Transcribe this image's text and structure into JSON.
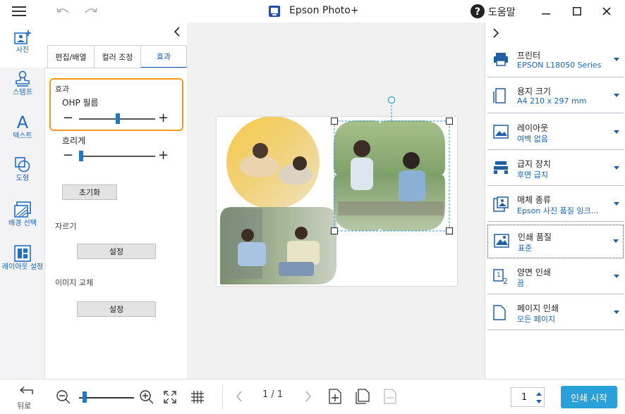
{
  "titlebar": {
    "title": "Epson Photo+",
    "help": "도움말"
  },
  "rail": {
    "items": [
      {
        "label": "사진"
      },
      {
        "label": "스탬프"
      },
      {
        "label": "텍스트"
      },
      {
        "label": "도형"
      },
      {
        "label": "배경 선택"
      },
      {
        "label": "레이아웃 설정"
      }
    ],
    "back_label": "뒤로"
  },
  "panel": {
    "tabs": [
      {
        "label": "편집/배열",
        "active": false
      },
      {
        "label": "컬러 조정",
        "active": false
      },
      {
        "label": "효과",
        "active": true
      }
    ],
    "effect_heading": "효과",
    "ohp_label": "OHP 필름",
    "ohp_level": 0.51,
    "blur_label": "흐리게",
    "blur_level": 0.03,
    "reset_label": "초기화",
    "crop_heading": "자르기",
    "crop_button": "설정",
    "replace_heading": "이미지 교체",
    "replace_button": "설정"
  },
  "settings": [
    {
      "title": "프린터",
      "value": "EPSON L18050 Series",
      "icon": "printer-icon"
    },
    {
      "title": "용지 크기",
      "value": "A4 210 x 297 mm",
      "icon": "paper-size-icon"
    },
    {
      "title": "레이아웃",
      "value": "여백 없음",
      "icon": "layout-icon"
    },
    {
      "title": "급지 장치",
      "value": "후면 급지",
      "icon": "feeder-icon"
    },
    {
      "title": "매체 종류",
      "value": "Epson 사진 품질 잉크…",
      "icon": "media-type-icon"
    },
    {
      "title": "인쇄 품질",
      "value": "표준",
      "icon": "print-quality-icon"
    },
    {
      "title": "양면 인쇄",
      "value": "끔",
      "icon": "duplex-icon"
    },
    {
      "title": "페이지 인쇄",
      "value": "모든 페이지",
      "icon": "page-icon"
    }
  ],
  "bottom": {
    "page_indicator": "1 / 1",
    "zoom_level": 0.1,
    "copies": "1",
    "print_label": "인쇄 시작"
  },
  "colors": {
    "accent": "#1565c0",
    "highlight": "#f39a1e",
    "print_button": "#2aa0d8"
  }
}
